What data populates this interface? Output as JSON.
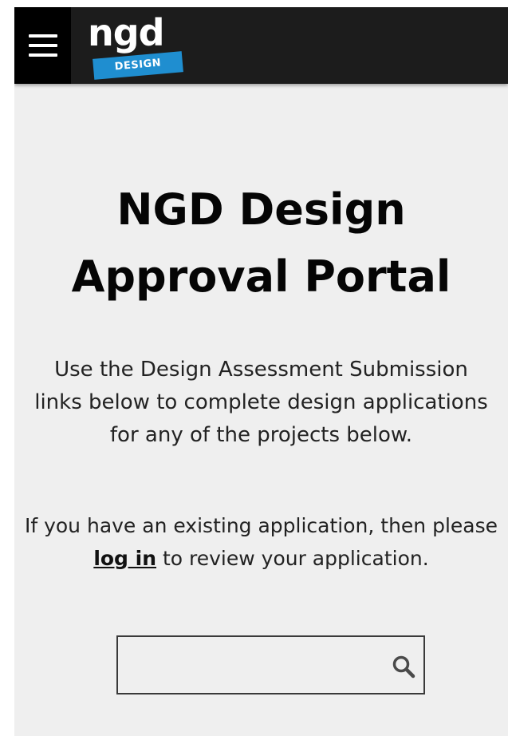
{
  "header": {
    "logo_text": "ngd",
    "logo_tag": "DESIGN"
  },
  "main": {
    "title_line1": "NGD Design",
    "title_line2": "Approval Portal",
    "intro": "Use the Design Assessment Submission links below to complete design applications for any of the projects below.",
    "login_prefix": "If you have an existing application, then please ",
    "login_link": "log in",
    "login_suffix": " to review your application."
  },
  "search": {
    "value": "",
    "placeholder": ""
  },
  "colors": {
    "header_bg": "#1c1c1c",
    "menu_bg": "#000000",
    "logo_accent": "#1f8ed0",
    "page_bg": "#efefef"
  },
  "icons": [
    "menu-icon",
    "search-icon"
  ]
}
